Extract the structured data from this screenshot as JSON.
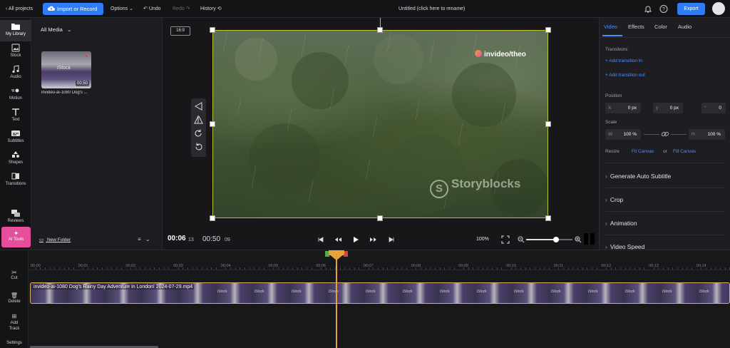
{
  "topbar": {
    "back_label": "All projects",
    "import_label": "Import or Record",
    "options_label": "Options",
    "undo_label": "Undo",
    "redo_label": "Redo",
    "history_label": "History",
    "project_title": "Untitled (click here to rename)",
    "export_label": "Export"
  },
  "sidebar": {
    "items": [
      {
        "label": "My Library",
        "icon": "folder-icon"
      },
      {
        "label": "Stock",
        "icon": "stock-icon"
      },
      {
        "label": "Audio",
        "icon": "music-note-icon"
      },
      {
        "label": "Motion",
        "icon": "motion-icon"
      },
      {
        "label": "Text",
        "icon": "text-icon"
      },
      {
        "label": "Subtitles",
        "icon": "subtitles-icon"
      },
      {
        "label": "Shapes",
        "icon": "shapes-icon"
      },
      {
        "label": "Transitions",
        "icon": "transitions-icon"
      },
      {
        "label": "Reviews",
        "icon": "reviews-icon"
      }
    ],
    "ai_tools_label": "AI Tools"
  },
  "library": {
    "filter_label": "All Media",
    "media": [
      {
        "name": "invideo-ai-1080 Dog's ...",
        "duration": "00:50",
        "watermark": "iStock"
      }
    ],
    "new_folder_label": "New Folder"
  },
  "preview": {
    "aspect_ratio": "16:9",
    "overlay_handle": "invideo/theo",
    "overlay_watermark": "Storyblocks",
    "current_time": "00:06",
    "current_frames": "13",
    "total_time": "00:50",
    "total_frames": "09",
    "zoom": "100%",
    "volume_level": 0.65
  },
  "rightpanel": {
    "tabs": [
      "Video",
      "Effects",
      "Color",
      "Audio"
    ],
    "active_tab": "Video",
    "transitions_label": "Transitions",
    "add_transition_in": "Add transition in",
    "add_transition_out": "Add transition out",
    "position_label": "Position",
    "x_key": "X",
    "x_value": "0 px",
    "y_key": "y",
    "y_value": "0 px",
    "rot_key": "°",
    "rot_value": "0",
    "scale_label": "Scale",
    "w_key": "W",
    "w_value": "100 %",
    "h_key": "H",
    "h_value": "100 %",
    "resize_label": "Resize",
    "fit_canvas_1": "Fit Canvas",
    "or_label": "or",
    "fit_canvas_2": "Fill Canvas",
    "sections": [
      "Generate Auto Subtitle",
      "Crop",
      "Animation",
      "Video Speed"
    ]
  },
  "timeline": {
    "tools": [
      "Cut",
      "Delete",
      "Add Track",
      "Settings"
    ],
    "ticks": [
      "00:00",
      "00:01",
      "00:02",
      "00:03",
      "00:04",
      "00:05",
      "00:06",
      "00:07",
      "00:08",
      "00:09",
      "00:10",
      "00:11",
      "00:12",
      "00:13",
      "00:14"
    ],
    "clip_name": "invideo-ai-1080 Dog's Rainy Day Adventure in London! 2024-07-29.mp4",
    "clip_thumb_label": "iStock"
  },
  "colors": {
    "accent": "#2f7cf6",
    "ai_tools": "#e64e9c",
    "playhead": "#e8a23a",
    "selection": "#b7c332"
  }
}
